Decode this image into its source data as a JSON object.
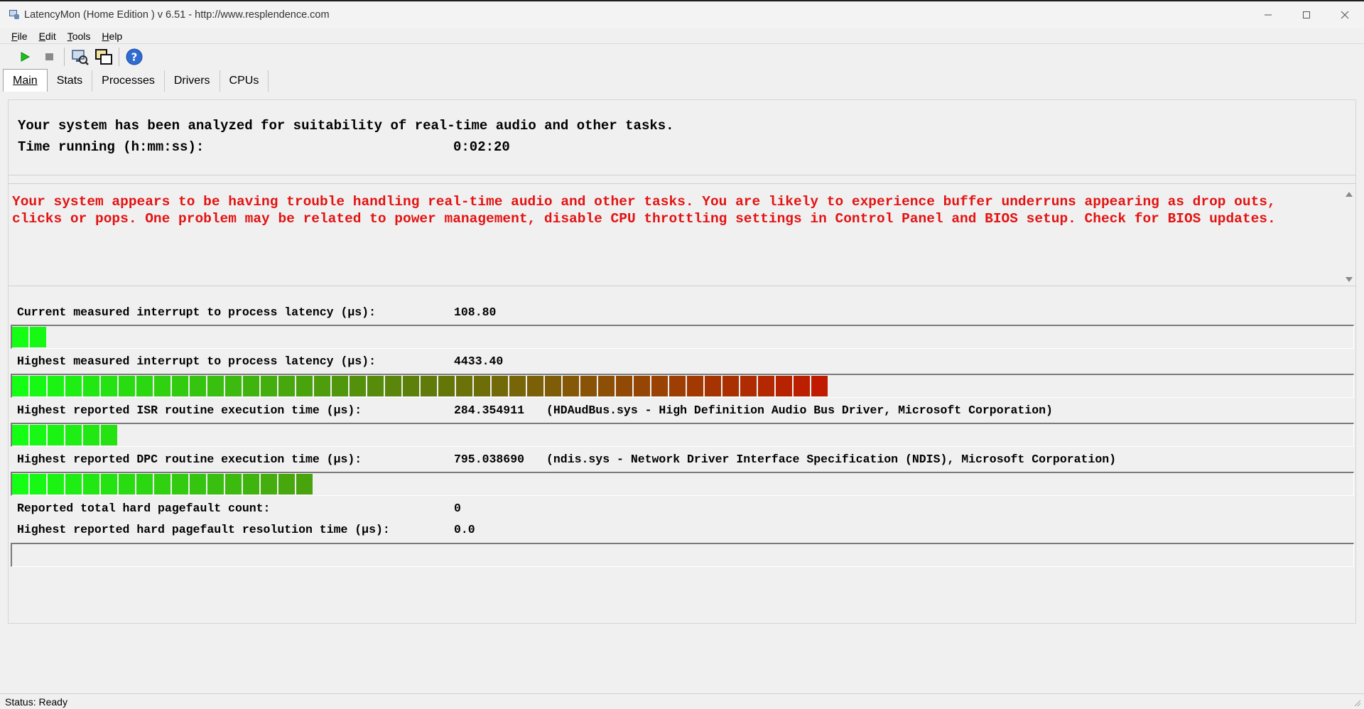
{
  "window": {
    "title": "LatencyMon  (Home Edition )  v 6.51 - http://www.resplendence.com",
    "minimize_icon": "minimize-icon",
    "maximize_icon": "maximize-icon",
    "close_icon": "close-icon"
  },
  "menu": {
    "items": [
      {
        "label": "File",
        "accel": "F",
        "rest": "ile"
      },
      {
        "label": "Edit",
        "accel": "E",
        "rest": "dit"
      },
      {
        "label": "Tools",
        "accel": "T",
        "rest": "ools"
      },
      {
        "label": "Help",
        "accel": "H",
        "rest": "elp"
      }
    ]
  },
  "toolbar": {
    "buttons": [
      "play-icon",
      "stop-icon",
      "system-info-icon",
      "copy-windows-icon",
      "help-icon"
    ]
  },
  "tabs": [
    {
      "label": "Main",
      "active": true
    },
    {
      "label": "Stats",
      "active": false
    },
    {
      "label": "Processes",
      "active": false
    },
    {
      "label": "Drivers",
      "active": false
    },
    {
      "label": "CPUs",
      "active": false
    }
  ],
  "summary": {
    "line1": "Your system has been analyzed for suitability of real-time audio and other tasks.",
    "time_label": "Time running (h:mm:ss):",
    "time_value": "0:02:20"
  },
  "advice": {
    "text": "Your system appears to be having trouble handling real-time audio and other tasks. You are likely to experience buffer underruns appearing as drop outs, clicks or pops. One problem may be related to power management, disable CPU throttling settings in Control Panel and BIOS setup. Check for BIOS updates.",
    "color": "#e41212"
  },
  "metrics": {
    "current_latency": {
      "label": "Current measured interrupt to process latency (µs):",
      "value": "108.80",
      "extra": "",
      "bar_segments": 2
    },
    "highest_latency": {
      "label": "Highest measured interrupt to process latency (µs):",
      "value": "4433.40",
      "extra": "",
      "bar_segments": 46
    },
    "isr": {
      "label": "Highest reported ISR routine execution time (µs):",
      "value": "284.354911",
      "extra": "(HDAudBus.sys - High Definition Audio Bus Driver, Microsoft Corporation)",
      "bar_segments": 6
    },
    "dpc": {
      "label": "Highest reported DPC routine execution time (µs):",
      "value": "795.038690",
      "extra": "(ndis.sys - Network Driver Interface Specification (NDIS), Microsoft Corporation)",
      "bar_segments": 17
    },
    "pagefault_count": {
      "label": "Reported total hard pagefault count:",
      "value": "0"
    },
    "pagefault_time": {
      "label": "Highest reported hard pagefault resolution time (µs):",
      "value": "0.0",
      "bar_segments": 0
    }
  },
  "status": {
    "text": "Status: Ready"
  },
  "colors": {
    "good": "#14ff14",
    "warn": "#5a7a0a",
    "bad": "#c01a00"
  }
}
